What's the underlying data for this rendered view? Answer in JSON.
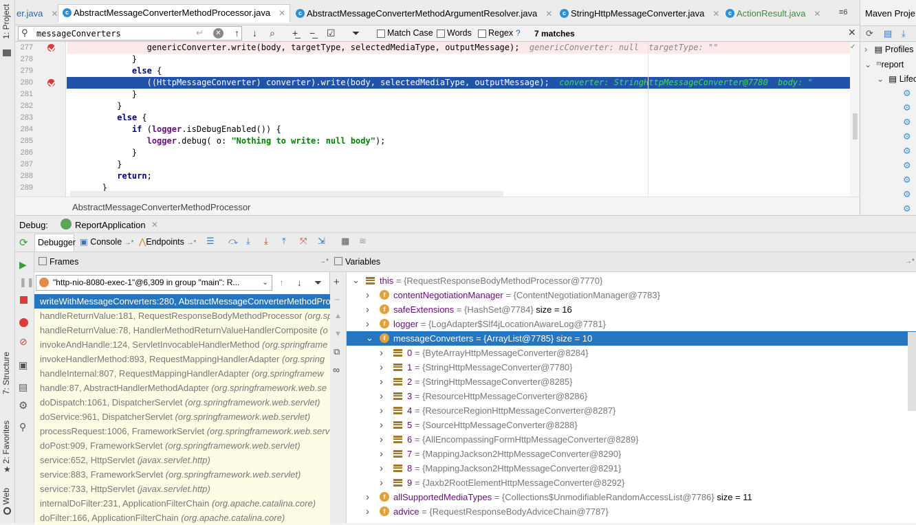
{
  "tool_windows_left": {
    "project": "1: Project",
    "structure": "7: Structure",
    "favorites": "2: Favorites",
    "web": "Web"
  },
  "editor_tabs": [
    {
      "label": "er.java",
      "icon": "class-icon"
    },
    {
      "label": "AbstractMessageConverterMethodProcessor.java",
      "icon": "class-icon",
      "active": true
    },
    {
      "label": "AbstractMessageConverterMethodArgumentResolver.java",
      "icon": "class-icon"
    },
    {
      "label": "StringHttpMessageConverter.java",
      "icon": "class-icon"
    },
    {
      "label": "ActionResult.java",
      "icon": "class-icon"
    }
  ],
  "tab_overflow": "≡6",
  "search": {
    "query": "messageConverters",
    "match_case": "Match Case",
    "words": "Words",
    "regex": "Regex",
    "help": "?",
    "matches": "7 matches"
  },
  "editor": {
    "lines": [
      {
        "num": "277",
        "breakpoint": true,
        "indent": "            ",
        "code": "genericConverter.write(body, targetType, selectedMediaType, outputMessage);",
        "hint": "genericConverter: null  targetType: \"\""
      },
      {
        "num": "278",
        "breakpoint": false,
        "indent": "         ",
        "code": "}",
        "hint": ""
      },
      {
        "num": "279",
        "breakpoint": false,
        "indent": "         ",
        "code": "else {",
        "hint": ""
      },
      {
        "num": "280",
        "breakpoint": true,
        "indent": "            ",
        "code": "((HttpMessageConverter) converter).write(body, selectedMediaType, outputMessage);",
        "hint": "converter: StringHttpMessageConverter@7780  body: \""
      },
      {
        "num": "281",
        "breakpoint": false,
        "indent": "         ",
        "code": "}",
        "hint": ""
      },
      {
        "num": "282",
        "breakpoint": false,
        "indent": "      ",
        "code": "}",
        "hint": ""
      },
      {
        "num": "283",
        "breakpoint": false,
        "indent": "      ",
        "code": "else {",
        "hint": ""
      },
      {
        "num": "284",
        "breakpoint": false,
        "indent": "         ",
        "code": "if (logger.isDebugEnabled()) {",
        "hint": ""
      },
      {
        "num": "285",
        "breakpoint": false,
        "indent": "            ",
        "code": "logger.debug( o: \"Nothing to write: null body\");",
        "hint": ""
      },
      {
        "num": "286",
        "breakpoint": false,
        "indent": "         ",
        "code": "}",
        "hint": ""
      },
      {
        "num": "287",
        "breakpoint": false,
        "indent": "      ",
        "code": "}",
        "hint": ""
      },
      {
        "num": "288",
        "breakpoint": false,
        "indent": "      ",
        "code": "return;",
        "hint": ""
      },
      {
        "num": "289",
        "breakpoint": false,
        "indent": "   ",
        "code": "}",
        "hint": ""
      }
    ],
    "breadcrumb": "AbstractMessageConverterMethodProcessor"
  },
  "maven": {
    "title": "Maven Proje",
    "profiles": "Profiles",
    "project": "report",
    "lifecycle": "Lifec"
  },
  "debug": {
    "label": "Debug:",
    "session": "ReportApplication",
    "tabs": {
      "debugger": "Debugger",
      "console": "Console",
      "endpoints": "Endpoints"
    },
    "frames_title": "Frames",
    "variables_title": "Variables",
    "thread": "\"http-nio-8080-exec-1\"@6,309 in group \"main\": R..."
  },
  "frames": [
    {
      "method": "writeWithMessageConverters:280, AbstractMessageConverterMethodPro",
      "pkg": "",
      "selected": true
    },
    {
      "method": "handleReturnValue:181, RequestResponseBodyMethodProcessor",
      "pkg": "(org.spri"
    },
    {
      "method": "handleReturnValue:78, HandlerMethodReturnValueHandlerComposite",
      "pkg": "(o"
    },
    {
      "method": "invokeAndHandle:124, ServletInvocableHandlerMethod",
      "pkg": "(org.springframe"
    },
    {
      "method": "invokeHandlerMethod:893, RequestMappingHandlerAdapter",
      "pkg": "(org.spring"
    },
    {
      "method": "handleInternal:807, RequestMappingHandlerAdapter",
      "pkg": "(org.springframew"
    },
    {
      "method": "handle:87, AbstractHandlerMethodAdapter",
      "pkg": "(org.springframework.web.se"
    },
    {
      "method": "doDispatch:1061, DispatcherServlet",
      "pkg": "(org.springframework.web.servlet)"
    },
    {
      "method": "doService:961, DispatcherServlet",
      "pkg": "(org.springframework.web.servlet)"
    },
    {
      "method": "processRequest:1006, FrameworkServlet",
      "pkg": "(org.springframework.web.serv"
    },
    {
      "method": "doPost:909, FrameworkServlet",
      "pkg": "(org.springframework.web.servlet)"
    },
    {
      "method": "service:652, HttpServlet",
      "pkg": "(javax.servlet.http)"
    },
    {
      "method": "service:883, FrameworkServlet",
      "pkg": "(org.springframework.web.servlet)"
    },
    {
      "method": "service:733, HttpServlet",
      "pkg": "(javax.servlet.http)"
    },
    {
      "method": "internalDoFilter:231, ApplicationFilterChain",
      "pkg": "(org.apache.catalina.core)"
    },
    {
      "method": "doFilter:166, ApplicationFilterChain",
      "pkg": "(org.apache.catalina.core)"
    }
  ],
  "variables": [
    {
      "level": 0,
      "expanded": true,
      "icon": "this",
      "name": "this",
      "value": "= {RequestResponseBodyMethodProcessor@7770}",
      "extra": ""
    },
    {
      "level": 1,
      "expanded": false,
      "icon": "field",
      "name": "contentNegotiationManager",
      "value": "= {ContentNegotiationManager@7783}",
      "extra": ""
    },
    {
      "level": 1,
      "expanded": false,
      "icon": "field",
      "name": "safeExtensions",
      "value": "= {HashSet@7784}",
      "extra": "size = 16"
    },
    {
      "level": 1,
      "expanded": false,
      "icon": "field",
      "name": "logger",
      "value": "= {LogAdapter$Slf4jLocationAwareLog@7781}",
      "extra": ""
    },
    {
      "level": 1,
      "expanded": true,
      "icon": "field",
      "name": "messageConverters",
      "value": "= {ArrayList@7785}",
      "extra": "size = 10",
      "selected": true
    },
    {
      "level": 2,
      "expanded": false,
      "icon": "array",
      "name": "0",
      "value": "= {ByteArrayHttpMessageConverter@8284}",
      "extra": ""
    },
    {
      "level": 2,
      "expanded": false,
      "icon": "array",
      "name": "1",
      "value": "= {StringHttpMessageConverter@7780}",
      "extra": ""
    },
    {
      "level": 2,
      "expanded": false,
      "icon": "array",
      "name": "2",
      "value": "= {StringHttpMessageConverter@8285}",
      "extra": ""
    },
    {
      "level": 2,
      "expanded": false,
      "icon": "array",
      "name": "3",
      "value": "= {ResourceHttpMessageConverter@8286}",
      "extra": ""
    },
    {
      "level": 2,
      "expanded": false,
      "icon": "array",
      "name": "4",
      "value": "= {ResourceRegionHttpMessageConverter@8287}",
      "extra": ""
    },
    {
      "level": 2,
      "expanded": false,
      "icon": "array",
      "name": "5",
      "value": "= {SourceHttpMessageConverter@8288}",
      "extra": ""
    },
    {
      "level": 2,
      "expanded": false,
      "icon": "array",
      "name": "6",
      "value": "= {AllEncompassingFormHttpMessageConverter@8289}",
      "extra": ""
    },
    {
      "level": 2,
      "expanded": false,
      "icon": "array",
      "name": "7",
      "value": "= {MappingJackson2HttpMessageConverter@8290}",
      "extra": ""
    },
    {
      "level": 2,
      "expanded": false,
      "icon": "array",
      "name": "8",
      "value": "= {MappingJackson2HttpMessageConverter@8291}",
      "extra": ""
    },
    {
      "level": 2,
      "expanded": false,
      "icon": "array",
      "name": "9",
      "value": "= {Jaxb2RootElementHttpMessageConverter@8292}",
      "extra": ""
    },
    {
      "level": 1,
      "expanded": false,
      "icon": "field",
      "name": "allSupportedMediaTypes",
      "value": "= {Collections$UnmodifiableRandomAccessList@7786}",
      "extra": "size = 11"
    },
    {
      "level": 1,
      "expanded": false,
      "icon": "field",
      "name": "advice",
      "value": "= {RequestResponseBodyAdviceChain@7787}",
      "extra": ""
    }
  ]
}
